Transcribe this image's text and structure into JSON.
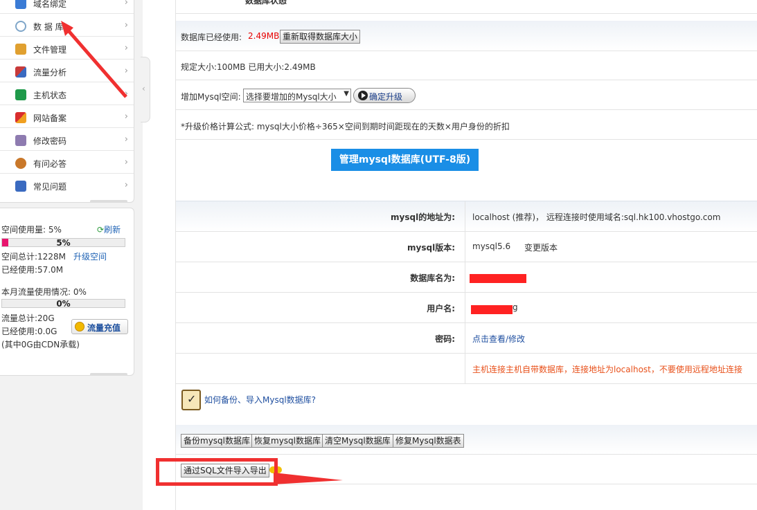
{
  "sidebar": {
    "items": [
      {
        "label": "域名绑定",
        "icon": "globe-icon",
        "color": "#3a7bd5"
      },
      {
        "label": "数 据 库",
        "icon": "database-icon",
        "color": "#7fa6c9"
      },
      {
        "label": "文件管理",
        "icon": "folder-user-icon",
        "color": "#e0a030"
      },
      {
        "label": "流量分析",
        "icon": "chart-icon",
        "color": "#c83a3a"
      },
      {
        "label": "主机状态",
        "icon": "power-icon",
        "color": "#1f9a4a"
      },
      {
        "label": "网站备案",
        "icon": "flag-icon",
        "color": "#d92d2d"
      },
      {
        "label": "修改密码",
        "icon": "key-icon",
        "color": "#8e7bb0"
      },
      {
        "label": "有问必答",
        "icon": "user-question-icon",
        "color": "#c9782a"
      },
      {
        "label": "常见问题",
        "icon": "faq-icon",
        "color": "#3a6ac0"
      }
    ]
  },
  "usage": {
    "space_label": "空间使用量: 5%",
    "refresh": "刷新",
    "space_pct": "5%",
    "space_fraction": 0.05,
    "space_total": "空间总计:1228M",
    "upgrade_space": "升级空间",
    "space_used": "已经使用:57.0M",
    "traffic_label": "本月流量使用情况: 0%",
    "traffic_pct": "0%",
    "traffic_fraction": 0,
    "traffic_total": "流量总计:20G",
    "traffic_used": "已经使用:0.0G",
    "cdn_note": "(其中0G由CDN承载)",
    "recharge": "流量充值"
  },
  "main": {
    "top_status_text": "数据库状态",
    "db_used_label": "数据库已经使用:",
    "db_used_value": "2.49MB",
    "refresh_size_btn": "重新取得数据库大小",
    "size_info": "规定大小:100MB 已用大小:2.49MB",
    "add_space_label": "增加Mysql空间:",
    "add_space_select": "选择要增加的Mysql大小",
    "confirm_upgrade": "确定升级",
    "formula": "*升级价格计算公式: mysql大小价格÷365×空间到期时间距现在的天数×用户身份的折扣",
    "manage_btn": "管理mysql数据库(UTF-8版)",
    "info_rows": [
      {
        "label": "mysql的地址为:",
        "value": "localhost (推荐)， 远程连接时使用域名:sql.hk100.vhostgo.com"
      },
      {
        "label": "mysql版本:",
        "value": "mysql5.6",
        "extra": "变更版本"
      },
      {
        "label": "数据库名为:",
        "value": ""
      },
      {
        "label": "用户名:",
        "value": "g"
      },
      {
        "label": "密码:",
        "value": "点击查看/修改"
      }
    ],
    "warning": "主机连接主机自带数据库，连接地址为localhost，不要使用远程地址连接",
    "backup_help": "如何备份、导入Mysql数据库?",
    "action_buttons": [
      "备份mysql数据库",
      "恢复mysql数据库",
      "清空Mysql数据库",
      "修复Mysql数据表"
    ],
    "sql_import_btn": "通过SQL文件导入导出"
  },
  "colors": {
    "annotation_red": "#f03030",
    "link_blue": "#1f63b5",
    "primary_button": "#1a8ee6",
    "warning_orange": "#e8501a"
  }
}
